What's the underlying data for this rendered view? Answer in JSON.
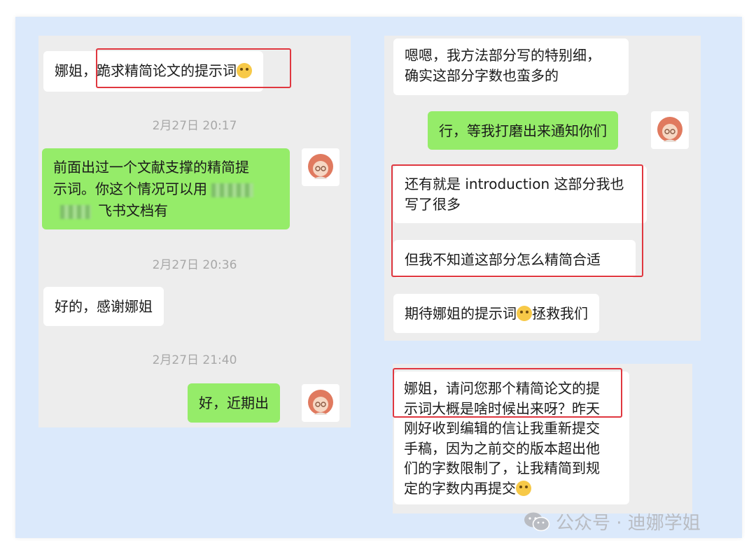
{
  "left_chat": {
    "msg1": {
      "prefix": "娜姐，",
      "highlight": "跪求精简论文的提示词"
    },
    "time1": "2月27日 20:17",
    "msg2": {
      "line1": "前面出过一个文献支撑的精简提",
      "line2": "示词。你这个情况可以用",
      "line3": "飞书文档有"
    },
    "time2": "2月27日 20:36",
    "msg3": "好的，感谢娜姐",
    "time3": "2月27日 21:40",
    "msg4": "好，近期出"
  },
  "right_chat": {
    "msg1": {
      "line1": "嗯嗯，我方法部分写的特别细，",
      "line2": "确实这部分字数也蛮多的"
    },
    "msg2": "行，等我打磨出来通知你们",
    "msg3": {
      "line1": "还有就是 introduction 这部分我也",
      "line2": "写了很多"
    },
    "msg4": "但我不知道这部分怎么精简合适",
    "msg5": {
      "before": "期待娜姐的提示词",
      "after": "拯救我们"
    }
  },
  "bottom_chat": {
    "msg1": {
      "line1": "娜姐，请问您那个精简论文的提",
      "line2": "示词大概是啥时候出来呀？昨天",
      "line3": "刚好收到编辑的信让我重新提交",
      "line4": "手稿，因为之前交的版本超出他",
      "line5": "们的字数限制了，让我精简到规",
      "line6": "定的字数内再提交"
    }
  },
  "watermark": {
    "text": "公众号 · 迪娜学姐",
    "icon": "wechat-icon"
  },
  "colors": {
    "green_bubble": "#95ec69",
    "highlight_box": "#e0373f",
    "background": "#dbe9fb"
  }
}
